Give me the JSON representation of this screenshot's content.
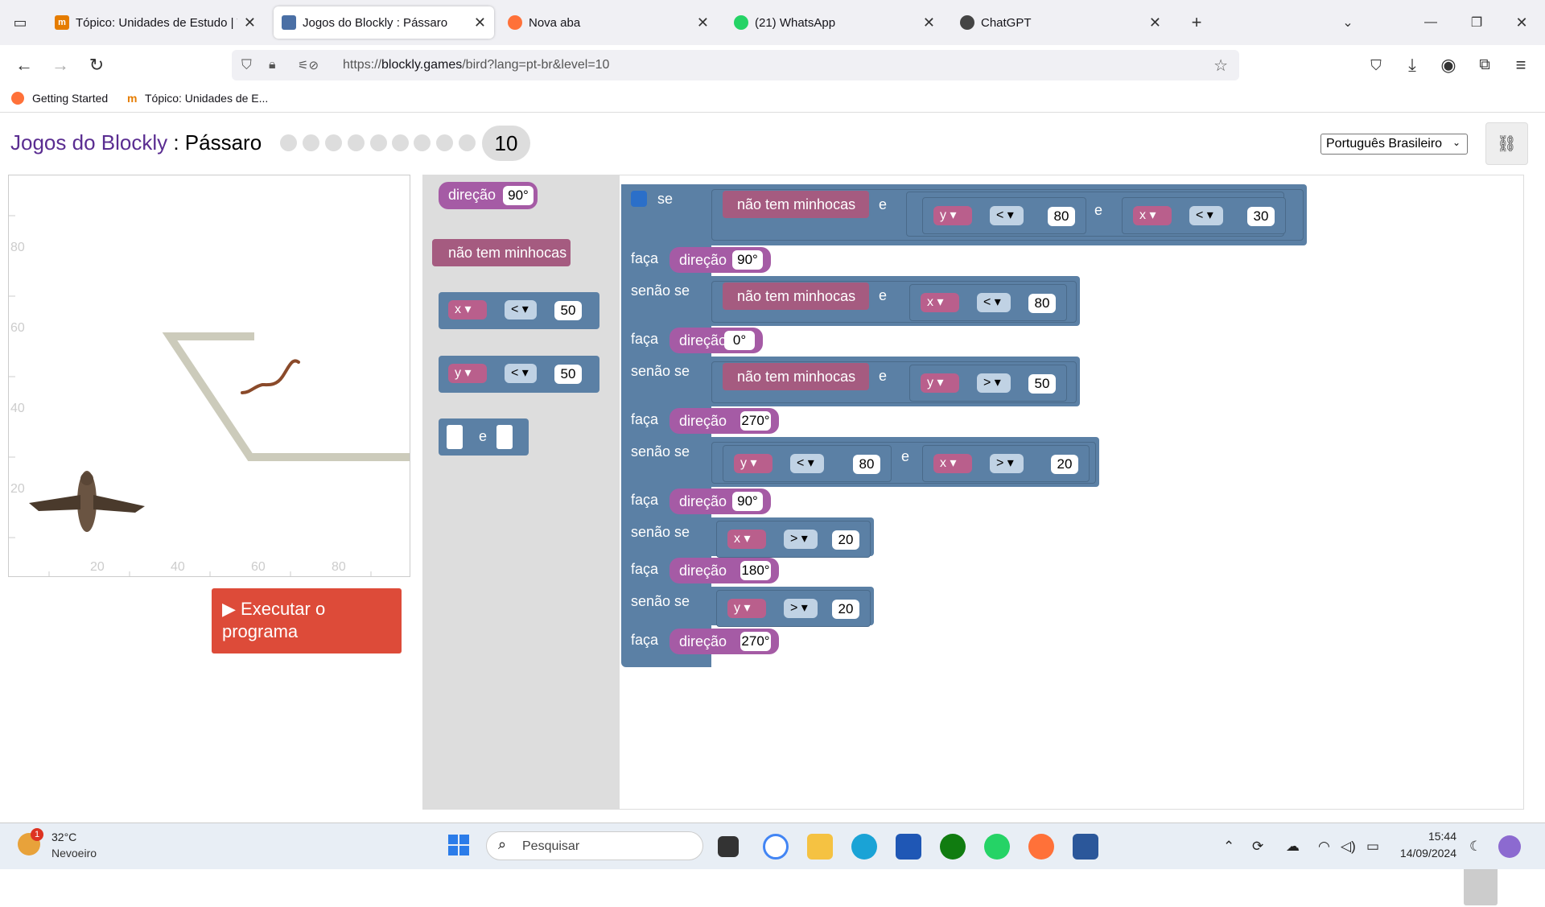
{
  "tabs": [
    {
      "title": "Tópico: Unidades de Estudo | Ta",
      "active": false
    },
    {
      "title": "Jogos do Blockly : Pássaro",
      "active": true
    },
    {
      "title": "Nova aba",
      "active": false
    },
    {
      "title": "(21) WhatsApp",
      "active": false
    },
    {
      "title": "ChatGPT",
      "active": false
    }
  ],
  "address": {
    "prefix": "https://",
    "domain": "blockly.games",
    "path": "/bird?lang=pt-br&level=10"
  },
  "bookmarks": [
    "Getting Started",
    "Tópico: Unidades de E..."
  ],
  "header": {
    "brand": "Jogos do Blockly",
    "sep": " : ",
    "game": "Pássaro",
    "level": "10",
    "language": "Português Brasileiro"
  },
  "axis": {
    "y": [
      "80",
      "60",
      "40",
      "20"
    ],
    "x": [
      "20",
      "40",
      "60",
      "80"
    ]
  },
  "run_button": "Executar o programa",
  "toolbox": {
    "heading": "direção",
    "heading_val": "90°",
    "no_worms": "não tem minhocas",
    "x": "x",
    "y": "y",
    "lt": "<",
    "val50": "50",
    "and": "e"
  },
  "code": {
    "if": "se",
    "elseif": "senão se",
    "do": "faça",
    "and": "e",
    "no_worms": "não tem minhocas",
    "heading": "direção",
    "c1": {
      "a": "y",
      "op1": "<",
      "v1": "80",
      "b": "x",
      "op2": "<",
      "v2": "30"
    },
    "h1": "90°",
    "c2": {
      "a": "x",
      "op": "<",
      "v": "80"
    },
    "h2": "0°",
    "c3": {
      "a": "y",
      "op": ">",
      "v": "50"
    },
    "h3": "270°",
    "c4": {
      "a": "y",
      "op1": "<",
      "v1": "80",
      "b": "x",
      "op2": ">",
      "v2": "20"
    },
    "h4": "90°",
    "c5": {
      "a": "x",
      "op": ">",
      "v": "20"
    },
    "h5": "180°",
    "c6": {
      "a": "y",
      "op": ">",
      "v": "20"
    },
    "h6": "270°"
  },
  "taskbar": {
    "weather_temp": "32°C",
    "weather_desc": "Nevoeiro",
    "weather_badge": "1",
    "search": "Pesquisar",
    "time": "15:44",
    "date": "14/09/2024"
  }
}
